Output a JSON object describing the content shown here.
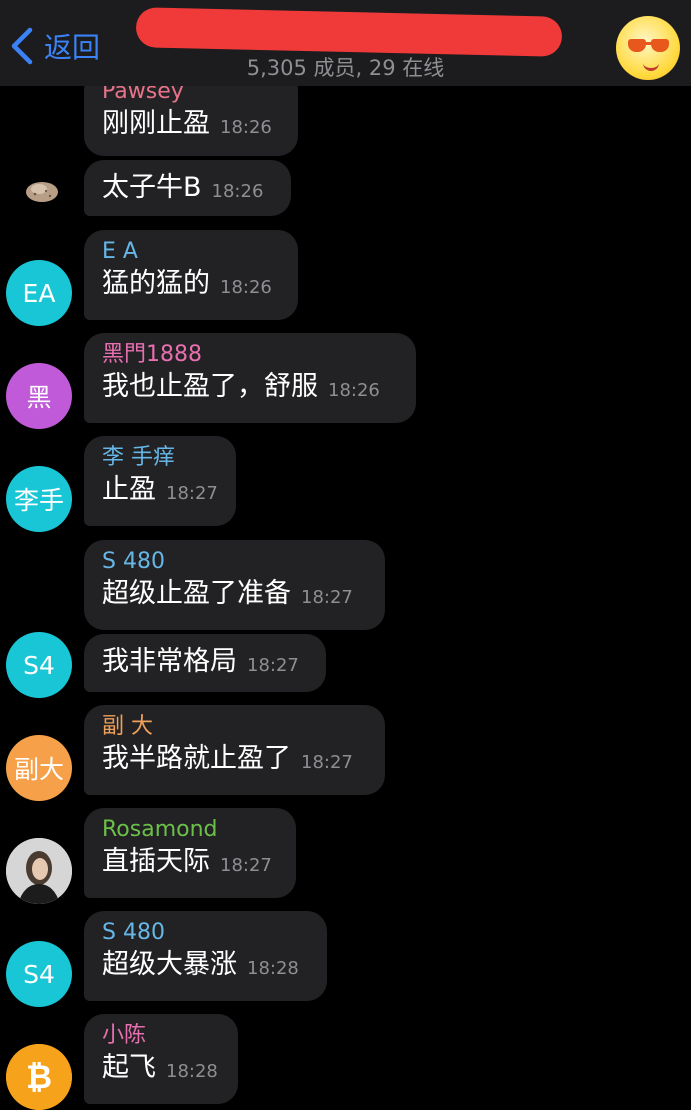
{
  "header": {
    "back_label": "返回",
    "members": "5,305 成员, 29 在线"
  },
  "colors": {
    "background": "#000000",
    "bubble": "#222224",
    "timestamp": "#8e8e93",
    "accent": "#3b82f6"
  },
  "messages": [
    {
      "sender": "Pawsey",
      "sender_color": "#e8738a",
      "text": "刚刚止盈",
      "time": "18:26"
    },
    {
      "sender": "",
      "text": "太子牛B",
      "time": "18:26",
      "avatar_icon": "rock-photo-icon"
    },
    {
      "sender": "E A",
      "sender_color": "#66b7e8",
      "text": "猛的猛的",
      "time": "18:26",
      "avatar_text": "EA",
      "avatar_color": "#18c6d6"
    },
    {
      "sender": "黑門1888",
      "sender_color": "#e86fb0",
      "text": "我也止盈了，舒服",
      "time": "18:26",
      "avatar_text": "黑",
      "avatar_color": "#c15ad9"
    },
    {
      "sender": "李 手痒",
      "sender_color": "#66b7e8",
      "text": "止盈",
      "time": "18:27",
      "avatar_text": "李手",
      "avatar_color": "#18c6d6"
    },
    {
      "sender": "S 480",
      "sender_color": "#66b7e8",
      "text": "超级止盈了准备",
      "time": "18:27"
    },
    {
      "sender": "",
      "text": "我非常格局",
      "time": "18:27",
      "avatar_text": "S4",
      "avatar_color": "#18c6d6"
    },
    {
      "sender": "副 大",
      "sender_color": "#f0a05a",
      "text": "我半路就止盈了",
      "time": "18:27",
      "avatar_text": "副大",
      "avatar_color": "#f7a04a"
    },
    {
      "sender": "Rosamond",
      "sender_color": "#6cc04a",
      "text": "直插天际",
      "time": "18:27",
      "avatar_icon": "person-photo-icon"
    },
    {
      "sender": "S 480",
      "sender_color": "#66b7e8",
      "text": "超级大暴涨",
      "time": "18:28",
      "avatar_text": "S4",
      "avatar_color": "#18c6d6"
    },
    {
      "sender": "小陈",
      "sender_color": "#e86fb0",
      "text": "起飞",
      "time": "18:28",
      "avatar_icon": "bitcoin-icon"
    }
  ]
}
